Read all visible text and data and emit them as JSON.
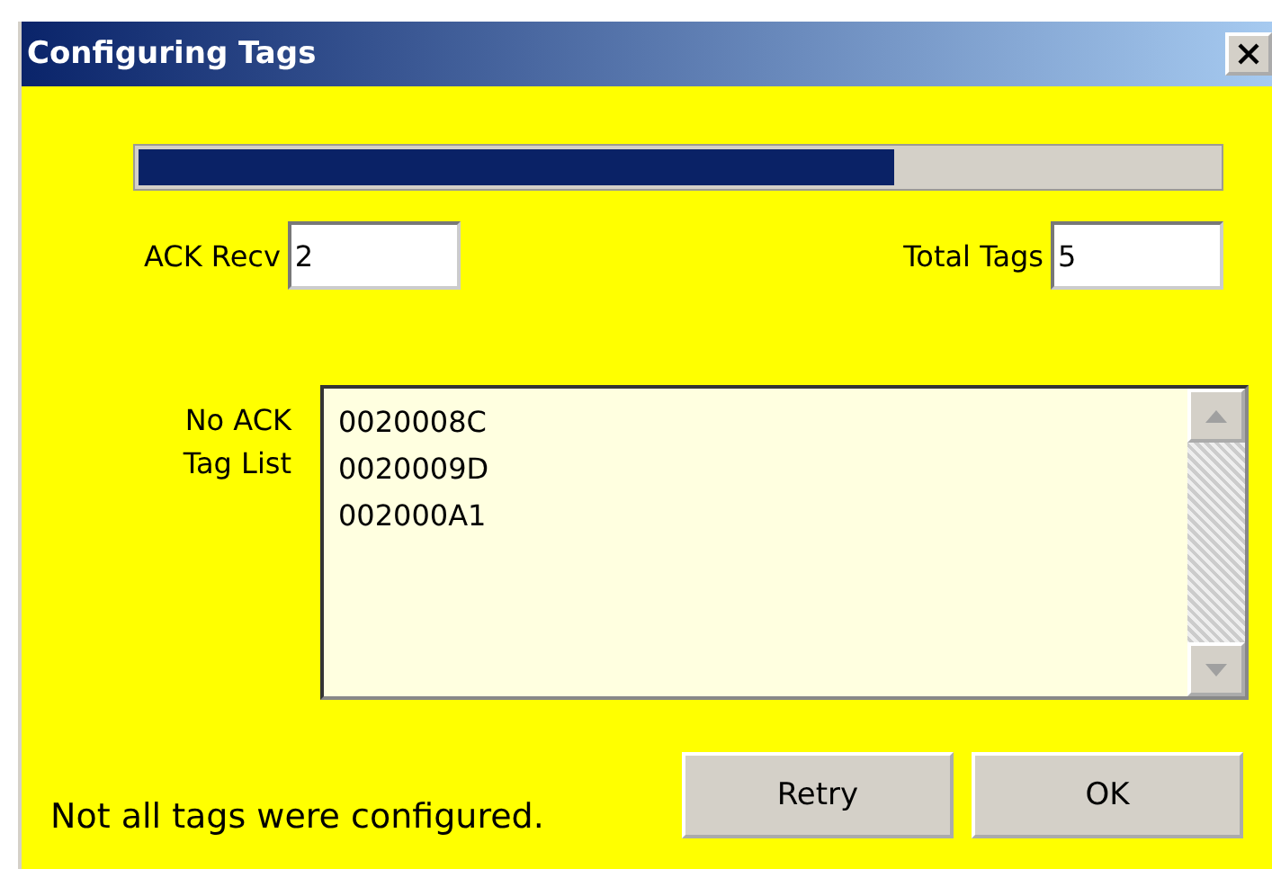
{
  "window": {
    "title": "Configuring Tags"
  },
  "progress": {
    "level": 0.7
  },
  "ack_recv": {
    "label": "ACK Recv",
    "value": "2"
  },
  "total_tags": {
    "label": "Total Tags",
    "value": "5"
  },
  "no_ack_list": {
    "label_lines": [
      "No ACK",
      "Tag List"
    ],
    "items": [
      "0020008C",
      "0020009D",
      "002000A1"
    ]
  },
  "status": "Not all tags were configured.",
  "buttons": [
    "Retry",
    "OK"
  ]
}
